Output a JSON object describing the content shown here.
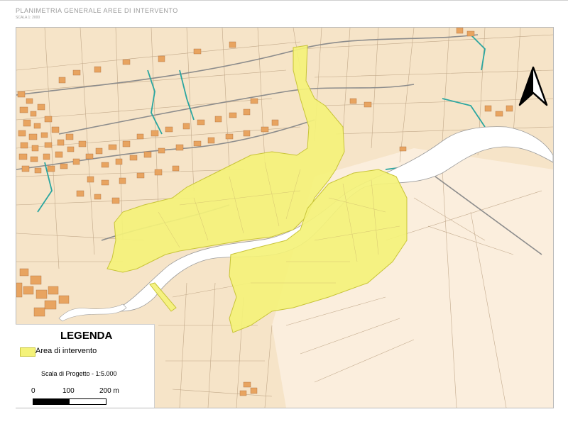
{
  "header": {
    "title": "PLANIMETRIA GENERALE AREE DI INTERVENTO",
    "scale_note": "SCALA 1: 2000"
  },
  "legend": {
    "title": "LEGENDA",
    "items": [
      {
        "label": "Area di intervento",
        "color": "#f4f279"
      }
    ],
    "scale_text": "Scala di Progetto - 1:5.000",
    "scalebar_labels": [
      "0",
      "100",
      "200 m"
    ]
  },
  "map": {
    "north_arrow": "north-arrow-icon",
    "colors": {
      "background": "#f6e4c8",
      "buildings": "#e8a460",
      "intervention_area": "#f4f279",
      "river": "#ffffff",
      "streams": "#2aa6a0",
      "roads": "#8c8c8c",
      "parcels": "#b59a7a"
    }
  }
}
